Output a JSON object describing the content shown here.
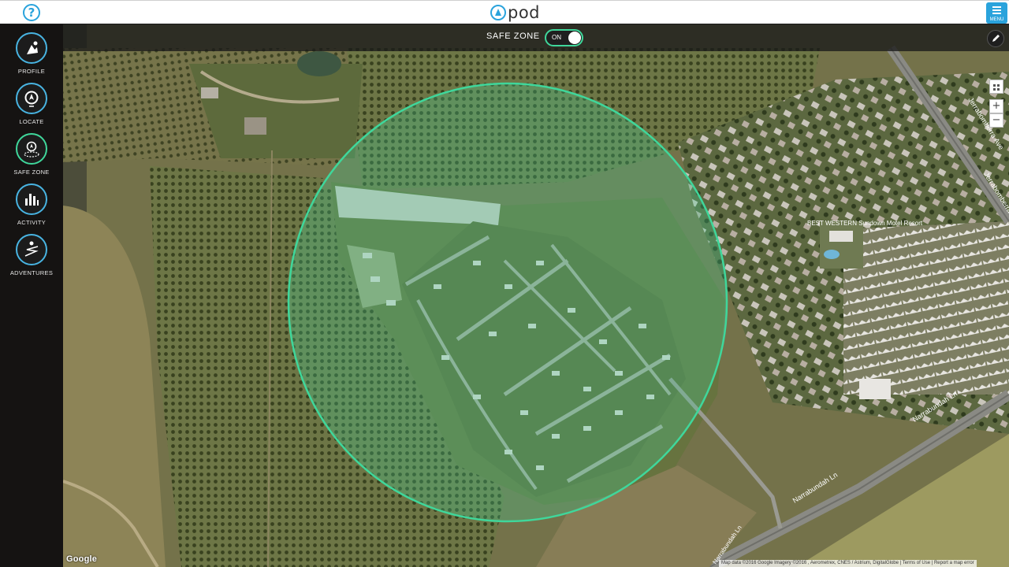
{
  "app": {
    "logo_text": "pod",
    "brand_color": "#2aa3dc",
    "menu_label": "MENU"
  },
  "sidebar": {
    "items": [
      {
        "label": "PROFILE",
        "icon": "profile-icon",
        "active": false
      },
      {
        "label": "LOCATE",
        "icon": "locate-icon",
        "active": false
      },
      {
        "label": "SAFE ZONE",
        "icon": "safe-zone-icon",
        "active": true
      },
      {
        "label": "ACTIVITY",
        "icon": "activity-icon",
        "active": false
      },
      {
        "label": "ADVENTURES",
        "icon": "adventures-icon",
        "active": false
      }
    ],
    "accent_color": "#48b4e2",
    "active_color": "#3fd79b"
  },
  "safe_zone": {
    "label": "SAFE ZONE",
    "toggle_text": "ON",
    "enabled": true,
    "zone_color": "#3fd79b"
  },
  "map": {
    "zoom_in": "+",
    "zoom_out": "−",
    "street_labels": [
      "Jerrabomberra Ave",
      "Jerrabomberra Ave",
      "Narrabundah Ln",
      "Narrabundah Ln",
      "Narrabundah Ln"
    ],
    "poi_label": "BEST WESTERN Sundown Motel Resort",
    "google_logo": "Google",
    "attribution": "Map data ©2016 Google Imagery ©2016 , Aerometrex, CNES / Astrium, DigitalGlobe  |  Terms of Use  |  Report a map error"
  }
}
